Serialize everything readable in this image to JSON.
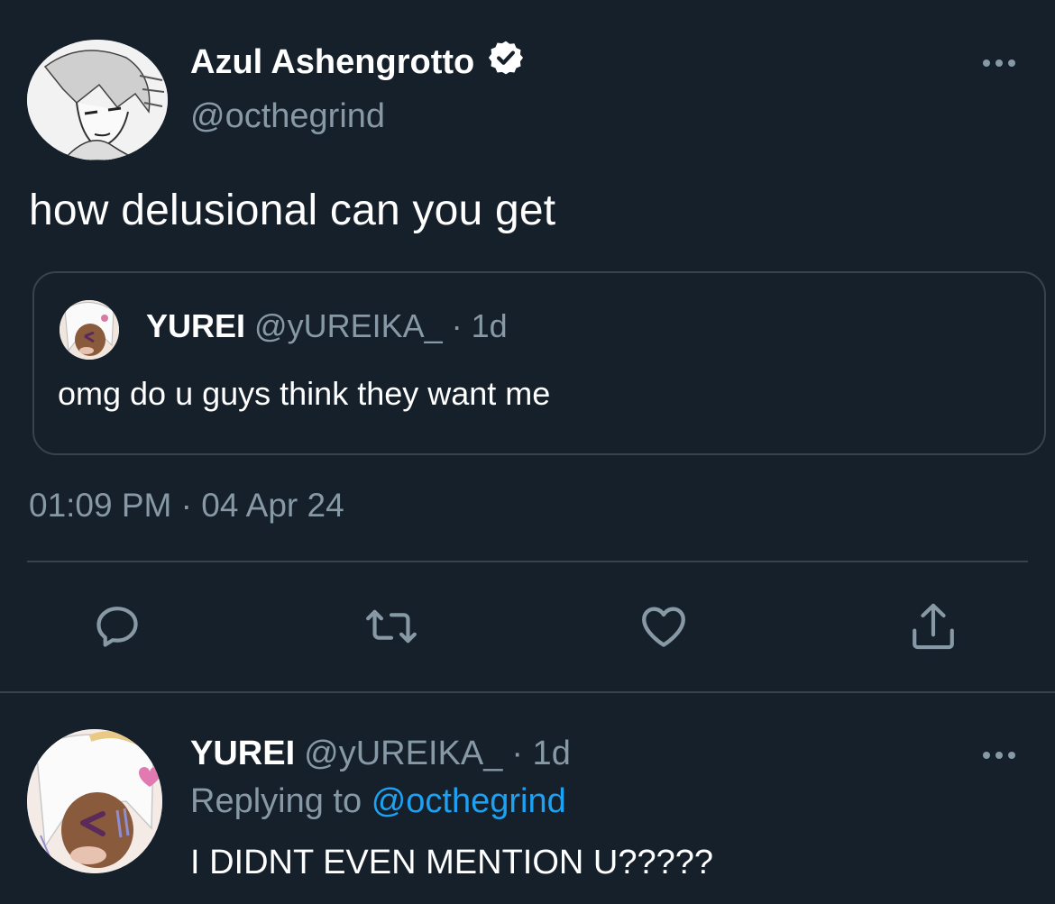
{
  "main_tweet": {
    "display_name": "Azul Ashengrotto",
    "handle": "@octhegrind",
    "text": "how delusional can you get",
    "timestamp": "01:09 PM · 04 Apr 24",
    "verified_icon": "verified-badge-icon",
    "more_icon": "more-dots-icon"
  },
  "quoted_tweet": {
    "display_name": "YUREI",
    "handle": "@yUREIKA_",
    "age": "· 1d",
    "text": "omg do u guys think they want me"
  },
  "actions": {
    "reply_icon": "reply-icon",
    "retweet_icon": "retweet-icon",
    "like_icon": "heart-icon",
    "share_icon": "share-icon"
  },
  "reply_tweet": {
    "display_name": "YUREI",
    "handle": "@yUREIKA_",
    "age": "· 1d",
    "replying_prefix": "Replying to",
    "replying_handle": "@octhegrind",
    "text": "I DIDNT EVEN MENTION U?????"
  },
  "colors": {
    "background": "#15202b",
    "secondary_text": "#8899a6",
    "border": "#38444d",
    "link": "#1da1f2"
  }
}
